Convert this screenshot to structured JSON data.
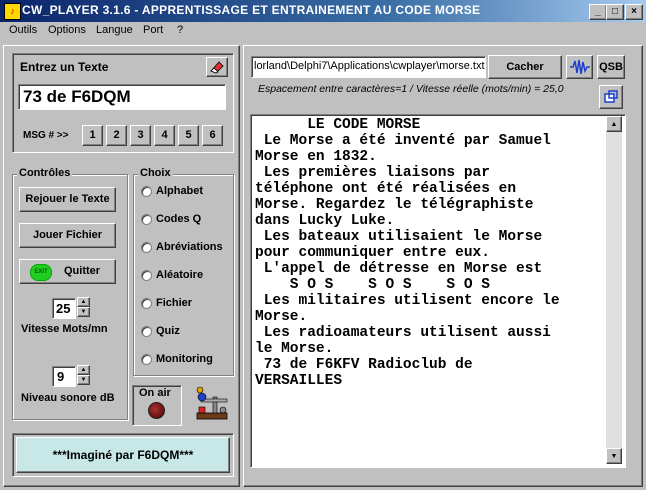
{
  "window": {
    "title": "CW_PLAYER 3.1.6 - APPRENTISSAGE  ET  ENTRAINEMENT AU CODE MORSE",
    "controls": [
      "_",
      "□",
      "×"
    ]
  },
  "menu": {
    "items": [
      "Outils",
      "Options",
      "Langue",
      "Port",
      "?"
    ]
  },
  "entry": {
    "label": "Entrez un Texte",
    "value": "73 de F6DQM",
    "msg_label": "MSG # >>",
    "msg_buttons": [
      "1",
      "2",
      "3",
      "4",
      "5",
      "6"
    ]
  },
  "controls": {
    "title": "Contrôles",
    "replay": "Rejouer le Texte",
    "play_file": "Jouer Fichier",
    "quit": "Quitter",
    "exit_badge": "EXIT",
    "speed_value": "25",
    "speed_label": "Vitesse Mots/mn",
    "volume_value": "9",
    "volume_label": "Niveau sonore dB"
  },
  "choix": {
    "title": "Choix",
    "options": [
      "Alphabet",
      "Codes Q",
      "Abréviations",
      "Aléatoire",
      "Fichier",
      "Quiz",
      "Monitoring"
    ]
  },
  "onair": {
    "label": "On air"
  },
  "credit": "***Imaginé par F6DQM***",
  "file": {
    "path": "lorland\\Delphi7\\Applications\\cwplayer\\morse.txt",
    "hide_button": "Cacher",
    "qsb_button": "QSB",
    "status": "Espacement entre caractères=1 / Vitesse réelle (mots/min) = 25,0"
  },
  "text_lines": [
    "      LE CODE MORSE",
    " Le Morse a été inventé par Samuel",
    "Morse en 1832.",
    " Les premières liaisons par",
    "téléphone ont été réalisées en",
    "Morse. Regardez le télégraphiste",
    "dans Lucky Luke.",
    " Les bateaux utilisaient le Morse",
    "pour communiquer entre eux.",
    " L'appel de détresse en Morse est",
    "    S O S    S O S    S O S",
    " Les militaires utilisent encore le",
    "Morse.",
    " Les radioamateurs utilisent aussi",
    "le Morse.",
    " 73 de F6KFV Radioclub de",
    "VERSAILLES"
  ],
  "colors": {
    "title_start": "#0a246a",
    "title_end": "#a6caf0",
    "credit_bg": "#c8e8e8",
    "face": "#c0c0c0",
    "exit_green": "#22cc22"
  }
}
